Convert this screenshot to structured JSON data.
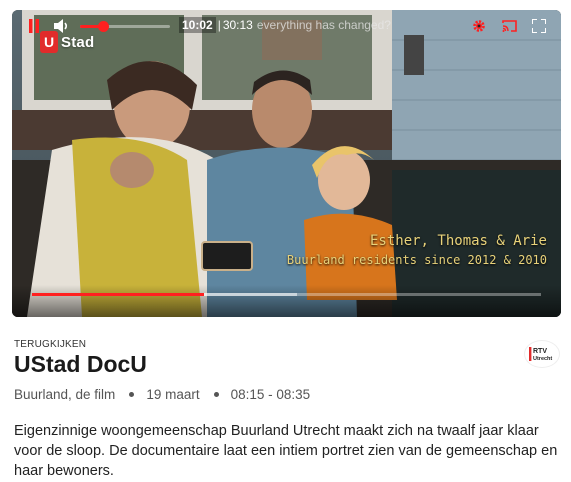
{
  "player": {
    "logo_letter": "U",
    "logo_text": "Stad",
    "subtitle_line1": "Esther, Thomas & Arie",
    "subtitle_line2": "Buurland residents since 2012 & 2010",
    "progress": 0.338,
    "buffered": 0.52,
    "volume": 0.25,
    "current_time": "10:02",
    "separator": "|",
    "duration": "30:13",
    "caption": "everything has changed?",
    "icons": [
      "pause-icon",
      "volume-icon",
      "settings-icon",
      "cast-icon",
      "fullscreen-icon"
    ],
    "accent": "#ff2020"
  },
  "program": {
    "kicker": "TERUGKIJKEN",
    "title": "UStad DocU",
    "series": "Buurland, de film",
    "date": "19 maart",
    "time": "08:15 - 08:35",
    "station_logo": {
      "line1": "RTV",
      "line2": "Utrecht"
    },
    "description": "Eigenzinnige woongemeenschap Buurland Utrecht maakt zich na twaalf jaar klaar voor de sloop. De documentaire laat een intiem portret zien van de gemeenschap en haar bewoners."
  }
}
